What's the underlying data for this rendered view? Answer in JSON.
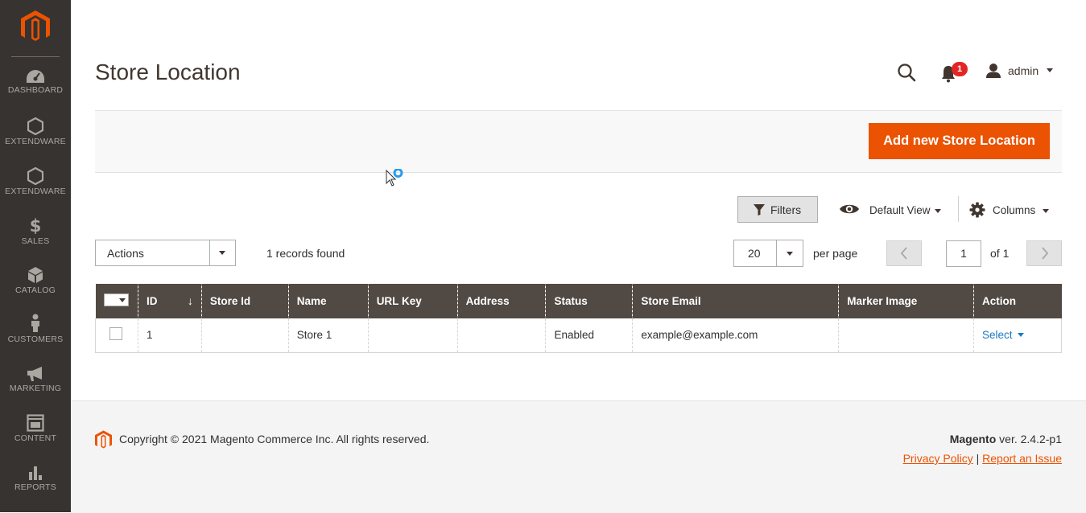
{
  "sidebar": {
    "logo": "magento-logo",
    "items": [
      {
        "label": "DASHBOARD",
        "icon": "speedometer-icon"
      },
      {
        "label": "EXTENDWARE",
        "icon": "hexagon-icon"
      },
      {
        "label": "EXTENDWARE",
        "icon": "hexagon-icon"
      },
      {
        "label": "SALES",
        "icon": "dollar-icon"
      },
      {
        "label": "CATALOG",
        "icon": "cube-icon"
      },
      {
        "label": "CUSTOMERS",
        "icon": "person-icon"
      },
      {
        "label": "MARKETING",
        "icon": "megaphone-icon"
      },
      {
        "label": "CONTENT",
        "icon": "layout-icon"
      },
      {
        "label": "REPORTS",
        "icon": "bar-chart-icon"
      }
    ]
  },
  "header": {
    "title": "Store Location",
    "notifications_count": "1",
    "user": "admin"
  },
  "action_bar": {
    "add_button": "Add new Store Location"
  },
  "grid_controls": {
    "filters_label": "Filters",
    "view_label": "Default View",
    "columns_label": "Columns",
    "actions_label": "Actions",
    "records_found": "1 records found",
    "per_page_value": "20",
    "per_page_label": "per page",
    "current_page": "1",
    "of_pages": "of 1"
  },
  "table": {
    "columns": [
      "ID",
      "Store Id",
      "Name",
      "URL Key",
      "Address",
      "Status",
      "Store Email",
      "Marker Image",
      "Action"
    ],
    "sort_indicator": "↓",
    "rows": [
      {
        "id": "1",
        "store_id": "",
        "name": "Store 1",
        "url_key": "",
        "address": "",
        "status": "Enabled",
        "email": "example@example.com",
        "marker_image": "",
        "action": "Select"
      }
    ]
  },
  "footer": {
    "copyright": "Copyright © 2021 Magento Commerce Inc. All rights reserved.",
    "brand": "Magento",
    "version": " ver. 2.4.2-p1",
    "privacy_link": "Privacy Policy",
    "separator": "|",
    "report_link": "Report an Issue"
  },
  "colors": {
    "sidebar_bg": "#373330",
    "accent": "#eb5202",
    "table_header": "#514943",
    "link": "#1979c3",
    "badge": "#e22626"
  }
}
